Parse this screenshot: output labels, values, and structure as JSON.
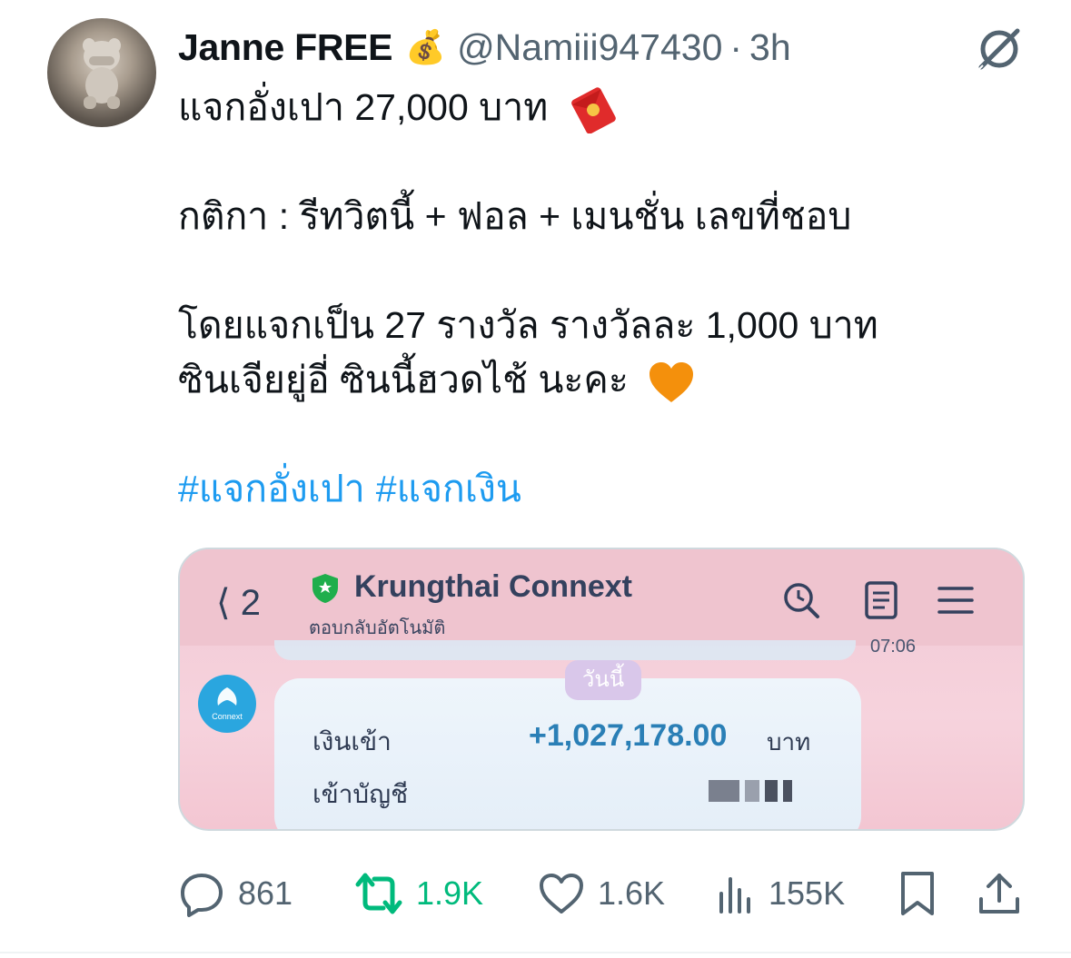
{
  "tweet": {
    "display_name": "Janne FREE",
    "badge_emoji": "💰",
    "handle": "@Namiii947430",
    "separator": "·",
    "time": "3h",
    "lines": [
      "แจกอั่งเปา 27,000 บาท",
      "กติกา : รีทวิตนี้ + ฟอล + เมนชั่น เลขที่ชอบ",
      "โดยแจกเป็น 27 รางวัล รางวัลละ 1,000 บาท",
      "ซินเจียยู่อี่ ซินนี้ฮวดไช้ นะคะ"
    ],
    "hashtags": [
      "#แจกอั่งเปา",
      "#แจกเงิน"
    ]
  },
  "media": {
    "back_count": "2",
    "app_title": "Krungthai Connext",
    "subtitle": "ตอบกลับอัตโนมัติ",
    "time_partial": "07:06",
    "logo_text": "Connext",
    "today_label": "วันนี้",
    "income_label": "เงินเข้า",
    "income_amount": "+1,027,178.00",
    "currency": "บาท",
    "account_label": "เข้าบัญชี"
  },
  "actions": {
    "replies": "861",
    "retweets": "1.9K",
    "likes": "1.6K",
    "views": "155K"
  },
  "colors": {
    "link": "#1d9bf0",
    "muted": "#536471",
    "retweet": "#00ba7c",
    "text": "#0f1419"
  },
  "icons": [
    "grok-icon",
    "reply-icon",
    "retweet-icon",
    "like-icon",
    "views-icon",
    "bookmark-icon",
    "share-icon"
  ]
}
